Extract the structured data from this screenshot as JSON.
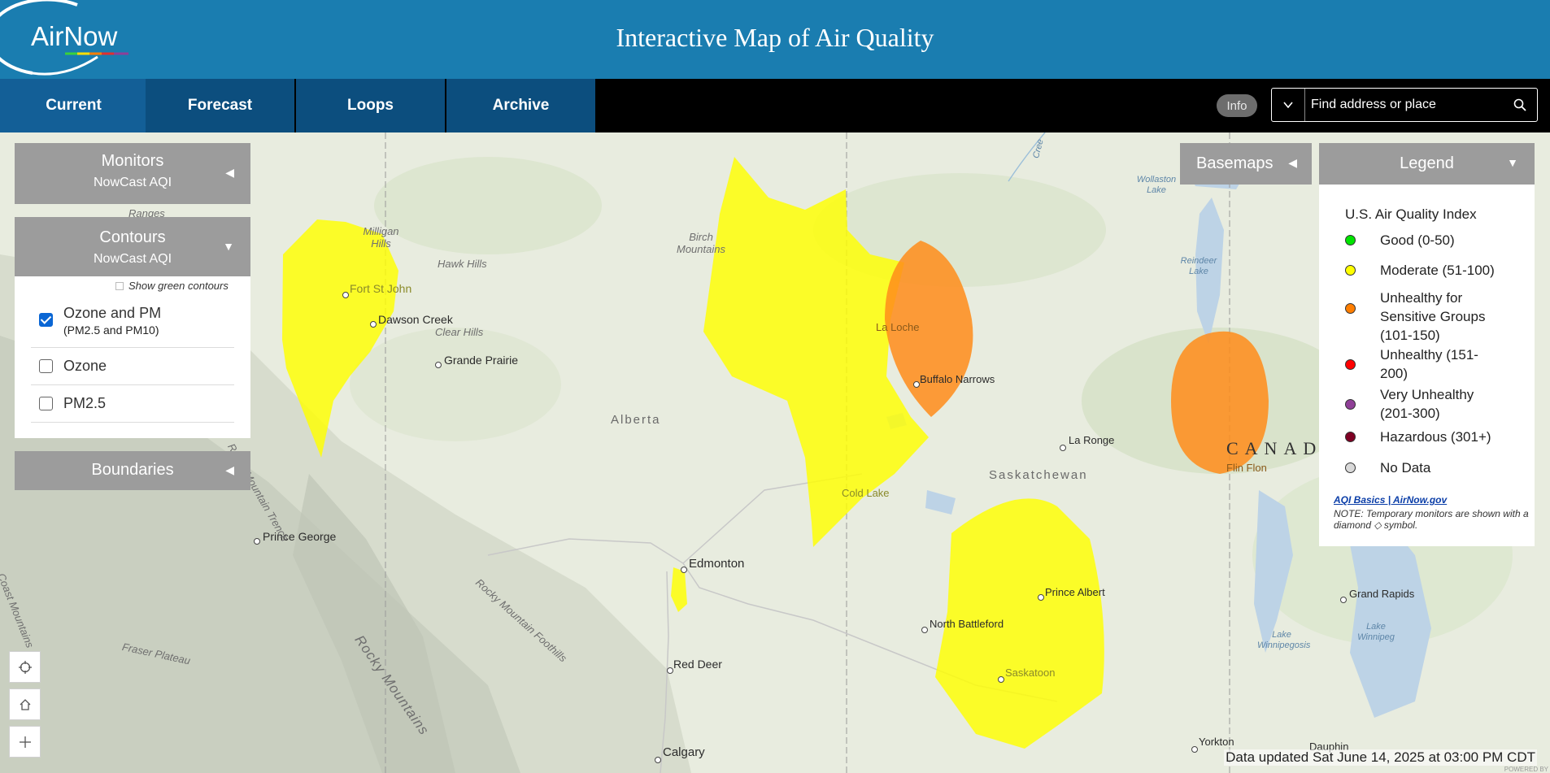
{
  "header": {
    "logo_text": "AirNow",
    "title": "Interactive Map of Air Quality"
  },
  "nav": {
    "tabs": [
      "Current",
      "Forecast",
      "Loops",
      "Archive"
    ],
    "info_label": "Info",
    "search_placeholder": "Find address or place"
  },
  "panels": {
    "monitors": {
      "title": "Monitors",
      "subtitle": "NowCast AQI"
    },
    "contours": {
      "title": "Contours",
      "subtitle": "NowCast AQI",
      "show_green_label": "Show green contours",
      "show_green_checked": false,
      "options": [
        {
          "label": "Ozone and PM",
          "sublabel": "(PM2.5 and PM10)",
          "checked": true
        },
        {
          "label": "Ozone",
          "sublabel": "",
          "checked": false
        },
        {
          "label": "PM2.5",
          "sublabel": "",
          "checked": false
        }
      ]
    },
    "boundaries": {
      "title": "Boundaries"
    },
    "basemaps": {
      "title": "Basemaps"
    }
  },
  "legend": {
    "title": "Legend",
    "heading": "U.S. Air Quality Index",
    "items": [
      {
        "label": "Good (0-50)",
        "color": "#00e400"
      },
      {
        "label": "Moderate (51-100)",
        "color": "#ffff00"
      },
      {
        "label": "Unhealthy for Sensitive Groups (101-150)",
        "color": "#ff7e00"
      },
      {
        "label": "Unhealthy (151-200)",
        "color": "#ff0000"
      },
      {
        "label": "Very Unhealthy (201-300)",
        "color": "#8f3f97"
      },
      {
        "label": "Hazardous (301+)",
        "color": "#7e0023"
      },
      {
        "label": "No Data",
        "color": "#d9d9d9"
      }
    ],
    "link_text": "AQI Basics | AirNow.gov",
    "note": "NOTE: Temporary monitors are shown with a diamond ◇ symbol."
  },
  "map": {
    "places": [
      "Fort St John",
      "Dawson Creek",
      "Grande Prairie",
      "Prince George",
      "Edmonton",
      "Red Deer",
      "Calgary",
      "La Loche",
      "Buffalo Narrows",
      "Cold Lake",
      "La Ronge",
      "Flin Flon",
      "Prince Albert",
      "North Battleford",
      "Saskatoon",
      "Grand Rapids",
      "Yorkton",
      "Dauphin"
    ],
    "regions": [
      "Alberta",
      "Saskatchewan",
      "CANADA"
    ],
    "features": [
      "Milligan Hills",
      "Hawk Hills",
      "Clear Hills",
      "Birch Mountains",
      "Rocky Mountains",
      "Rocky Mountain Foothills",
      "Fraser Plateau",
      "Rocky Mountain Trench",
      "Coast Mountains",
      "Cree",
      "Ranges"
    ],
    "water": [
      "Wollaston Lake",
      "Reindeer Lake",
      "Lake Winnipegosis",
      "Lake Winnipeg"
    ]
  },
  "status": {
    "updated": "Data updated Sat June 14, 2025 at 03:00 PM CDT",
    "powered": "POWERED BY"
  }
}
